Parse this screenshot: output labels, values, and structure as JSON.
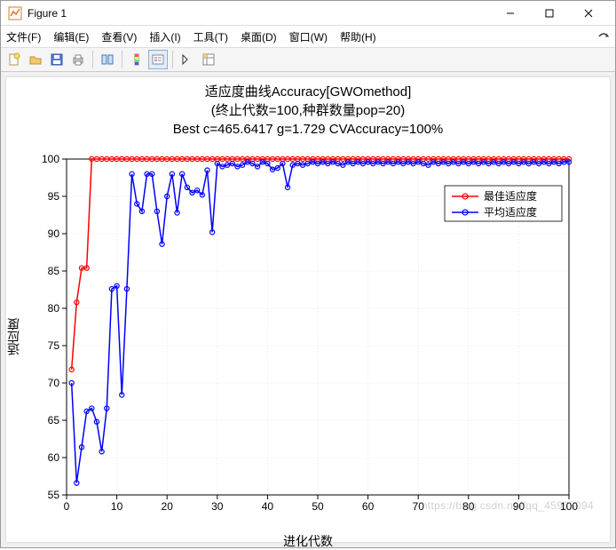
{
  "window": {
    "title": "Figure 1",
    "minimize": "—",
    "maximize": "☐",
    "close": "✕"
  },
  "menu": {
    "file": "文件(F)",
    "edit": "编辑(E)",
    "view": "查看(V)",
    "insert": "插入(I)",
    "tools": "工具(T)",
    "desktop": "桌面(D)",
    "window_menu": "窗口(W)",
    "help": "帮助(H)"
  },
  "chart_titles": {
    "line1": "适应度曲线Accuracy[GWOmethod]",
    "line2": "(终止代数=100,种群数量pop=20)",
    "line3": "Best c=465.6417 g=1.729 CVAccuracy=100%"
  },
  "axes": {
    "xlabel": "进化代数",
    "ylabel": "适应度"
  },
  "legend": {
    "best": "最佳适应度",
    "avg": "平均适应度"
  },
  "watermark": "https://blog.csdn.net/qq_45955094",
  "chart_data": {
    "type": "line",
    "xlabel": "进化代数",
    "ylabel": "适应度",
    "xlim": [
      0,
      100
    ],
    "ylim": [
      55,
      100
    ],
    "xticks": [
      0,
      10,
      20,
      30,
      40,
      50,
      60,
      70,
      80,
      90,
      100
    ],
    "yticks": [
      55,
      60,
      65,
      70,
      75,
      80,
      85,
      90,
      95,
      100
    ],
    "title": "适应度曲线Accuracy[GWOmethod]\n(终止代数=100,种群数量pop=20)\nBest c=465.6417 g=1.729 CVAccuracy=100%",
    "series": [
      {
        "name": "最佳适应度",
        "color": "#ff0000",
        "marker": "o",
        "x": [
          1,
          2,
          3,
          4,
          5,
          6,
          7,
          8,
          9,
          10,
          11,
          12,
          13,
          14,
          15,
          16,
          17,
          18,
          19,
          20,
          21,
          22,
          23,
          24,
          25,
          26,
          27,
          28,
          29,
          30,
          31,
          32,
          33,
          34,
          35,
          36,
          37,
          38,
          39,
          40,
          41,
          42,
          43,
          44,
          45,
          46,
          47,
          48,
          49,
          50,
          51,
          52,
          53,
          54,
          55,
          56,
          57,
          58,
          59,
          60,
          61,
          62,
          63,
          64,
          65,
          66,
          67,
          68,
          69,
          70,
          71,
          72,
          73,
          74,
          75,
          76,
          77,
          78,
          79,
          80,
          81,
          82,
          83,
          84,
          85,
          86,
          87,
          88,
          89,
          90,
          91,
          92,
          93,
          94,
          95,
          96,
          97,
          98,
          99,
          100
        ],
        "y": [
          71.8,
          80.8,
          85.4,
          85.4,
          100,
          100,
          100,
          100,
          100,
          100,
          100,
          100,
          100,
          100,
          100,
          100,
          100,
          100,
          100,
          100,
          100,
          100,
          100,
          100,
          100,
          100,
          100,
          100,
          100,
          100,
          100,
          100,
          100,
          100,
          100,
          100,
          100,
          100,
          100,
          100,
          100,
          100,
          100,
          100,
          100,
          100,
          100,
          100,
          100,
          100,
          100,
          100,
          100,
          100,
          100,
          100,
          100,
          100,
          100,
          100,
          100,
          100,
          100,
          100,
          100,
          100,
          100,
          100,
          100,
          100,
          100,
          100,
          100,
          100,
          100,
          100,
          100,
          100,
          100,
          100,
          100,
          100,
          100,
          100,
          100,
          100,
          100,
          100,
          100,
          100,
          100,
          100,
          100,
          100,
          100,
          100,
          100,
          100,
          100,
          100
        ]
      },
      {
        "name": "平均适应度",
        "color": "#0000ff",
        "marker": "o",
        "x": [
          1,
          2,
          3,
          4,
          5,
          6,
          7,
          8,
          9,
          10,
          11,
          12,
          13,
          14,
          15,
          16,
          17,
          18,
          19,
          20,
          21,
          22,
          23,
          24,
          25,
          26,
          27,
          28,
          29,
          30,
          31,
          32,
          33,
          34,
          35,
          36,
          37,
          38,
          39,
          40,
          41,
          42,
          43,
          44,
          45,
          46,
          47,
          48,
          49,
          50,
          51,
          52,
          53,
          54,
          55,
          56,
          57,
          58,
          59,
          60,
          61,
          62,
          63,
          64,
          65,
          66,
          67,
          68,
          69,
          70,
          71,
          72,
          73,
          74,
          75,
          76,
          77,
          78,
          79,
          80,
          81,
          82,
          83,
          84,
          85,
          86,
          87,
          88,
          89,
          90,
          91,
          92,
          93,
          94,
          95,
          96,
          97,
          98,
          99,
          100
        ],
        "y": [
          70.0,
          56.6,
          61.4,
          66.2,
          66.6,
          64.8,
          60.8,
          66.6,
          82.6,
          83.0,
          68.4,
          82.6,
          98.0,
          94.0,
          93.0,
          98.0,
          98.0,
          93.0,
          88.6,
          95.0,
          98.0,
          92.8,
          98.0,
          96.2,
          95.5,
          95.8,
          95.2,
          98.5,
          90.2,
          99.4,
          99.0,
          99.2,
          99.4,
          99.0,
          99.2,
          99.6,
          99.4,
          99.0,
          99.6,
          99.4,
          98.6,
          98.8,
          99.4,
          96.2,
          99.2,
          99.4,
          99.2,
          99.4,
          99.6,
          99.4,
          99.6,
          99.4,
          99.6,
          99.4,
          99.2,
          99.6,
          99.4,
          99.6,
          99.4,
          99.6,
          99.4,
          99.6,
          99.4,
          99.6,
          99.4,
          99.6,
          99.4,
          99.6,
          99.4,
          99.6,
          99.4,
          99.2,
          99.6,
          99.4,
          99.6,
          99.4,
          99.6,
          99.4,
          99.6,
          99.4,
          99.6,
          99.4,
          99.6,
          99.4,
          99.6,
          99.4,
          99.6,
          99.4,
          99.6,
          99.4,
          99.6,
          99.4,
          99.6,
          99.4,
          99.6,
          99.4,
          99.6,
          99.4,
          99.6,
          99.6
        ]
      }
    ]
  }
}
